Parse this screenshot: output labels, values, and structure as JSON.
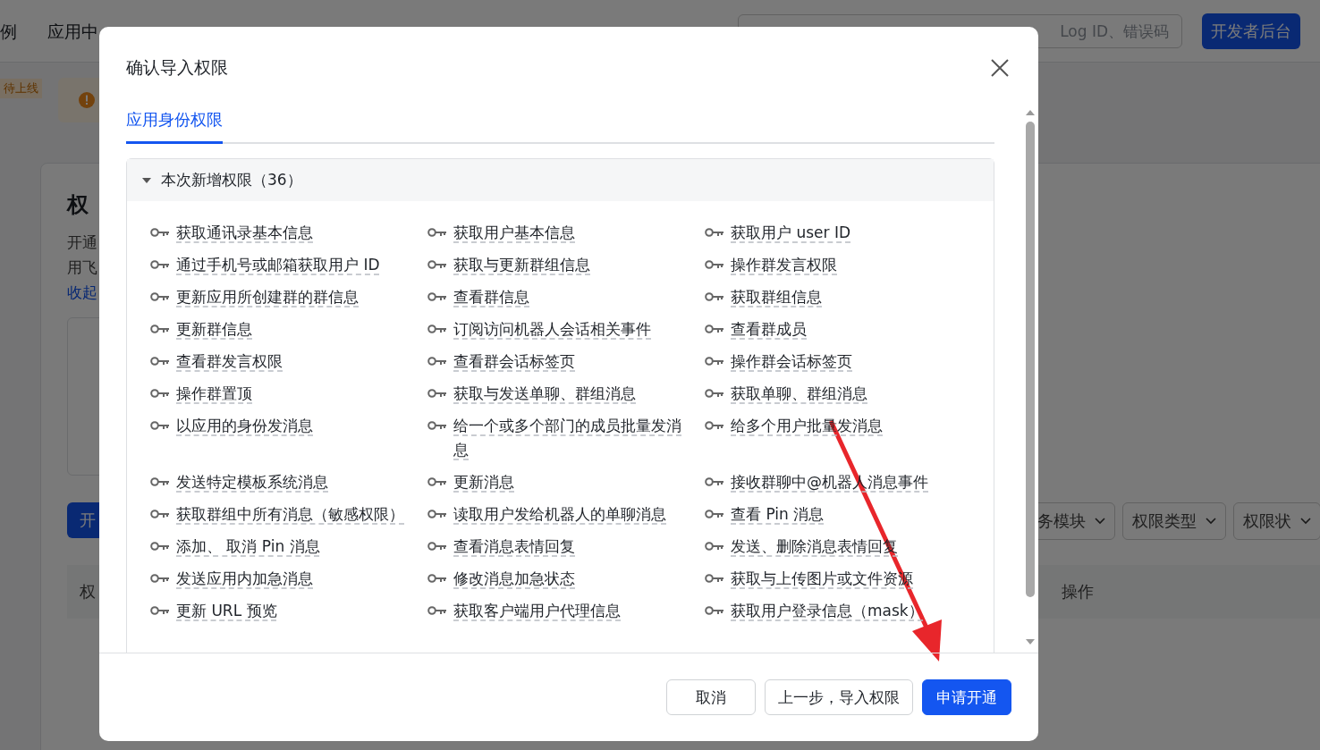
{
  "page": {
    "nav": [
      "例",
      "应用中"
    ],
    "search": {
      "placeholder": "Log ID、错误码"
    },
    "console_button": "开发者后台",
    "status_tag": "待上线",
    "section_title": "权",
    "description_lines": [
      "开通",
      "用飞"
    ],
    "collapse_link": "收起",
    "primary_button": "开",
    "filters": [
      "务模块",
      "权限类型",
      "权限状"
    ],
    "table_columns": [
      "权",
      "操作"
    ]
  },
  "dialog": {
    "title": "确认导入权限",
    "tabs": [
      {
        "label": "应用身份权限",
        "selected": true
      }
    ],
    "section": {
      "title": "本次新增权限（36）",
      "expanded": true,
      "permissions": [
        "获取通讯录基本信息",
        "获取用户基本信息",
        "获取用户 user ID",
        "通过手机号或邮箱获取用户 ID",
        "获取与更新群组信息",
        "操作群发言权限",
        "更新应用所创建群的群信息",
        "查看群信息",
        "获取群组信息",
        "更新群信息",
        "订阅访问机器人会话相关事件",
        "查看群成员",
        "查看群发言权限",
        "查看群会话标签页",
        "操作群会话标签页",
        "操作群置顶",
        "获取与发送单聊、群组消息",
        "获取单聊、群组消息",
        "以应用的身份发消息",
        "给一个或多个部门的成员批量发消息",
        "给多个用户批量发消息",
        "发送特定模板系统消息",
        "更新消息",
        "接收群聊中@机器人消息事件",
        "获取群组中所有消息（敏感权限）",
        "读取用户发给机器人的单聊消息",
        "查看 Pin 消息",
        "添加、 取消 Pin 消息",
        "查看消息表情回复",
        "发送、删除消息表情回复",
        "发送应用内加急消息",
        "修改消息加急状态",
        "获取与上传图片或文件资源",
        "更新 URL 预览",
        "获取客户端用户代理信息",
        "获取用户登录信息（mask）"
      ]
    },
    "buttons": [
      {
        "label": "取消",
        "kind": "default"
      },
      {
        "label": "上一步，导入权限",
        "kind": "default"
      },
      {
        "label": "申请开通",
        "kind": "primary"
      }
    ]
  }
}
